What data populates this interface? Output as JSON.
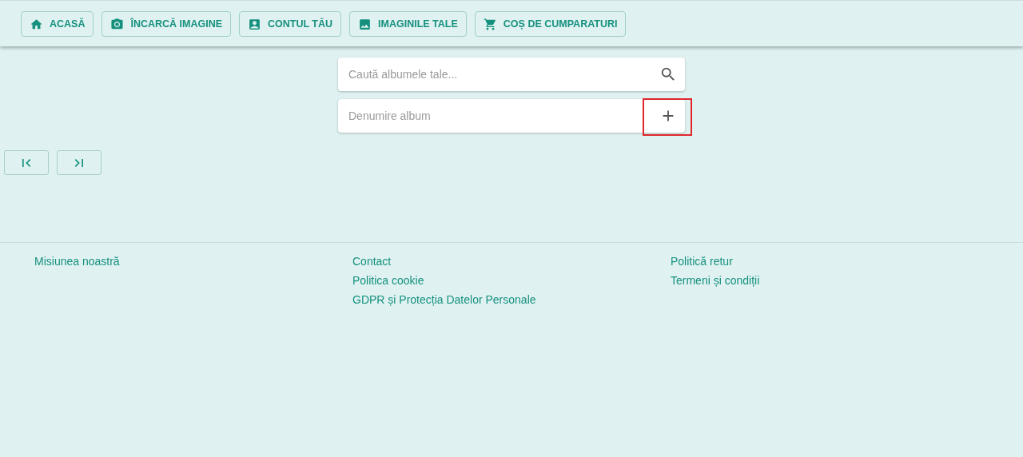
{
  "nav": [
    {
      "label": "ACASĂ"
    },
    {
      "label": "ÎNCARCĂ IMAGINE"
    },
    {
      "label": "CONTUL TĂU"
    },
    {
      "label": "IMAGINILE TALE"
    },
    {
      "label": "COȘ DE CUMPARATURI"
    }
  ],
  "search": {
    "placeholder": "Caută albumele tale..."
  },
  "new_album": {
    "placeholder": "Denumire album",
    "add_highlighted": true
  },
  "footer": {
    "columns": [
      [
        "Misiunea noastră"
      ],
      [
        "Contact",
        "Politica cookie",
        "GDPR și Protecția Datelor Personale"
      ],
      [
        "Politică retur",
        "Termeni și condiții"
      ]
    ]
  }
}
